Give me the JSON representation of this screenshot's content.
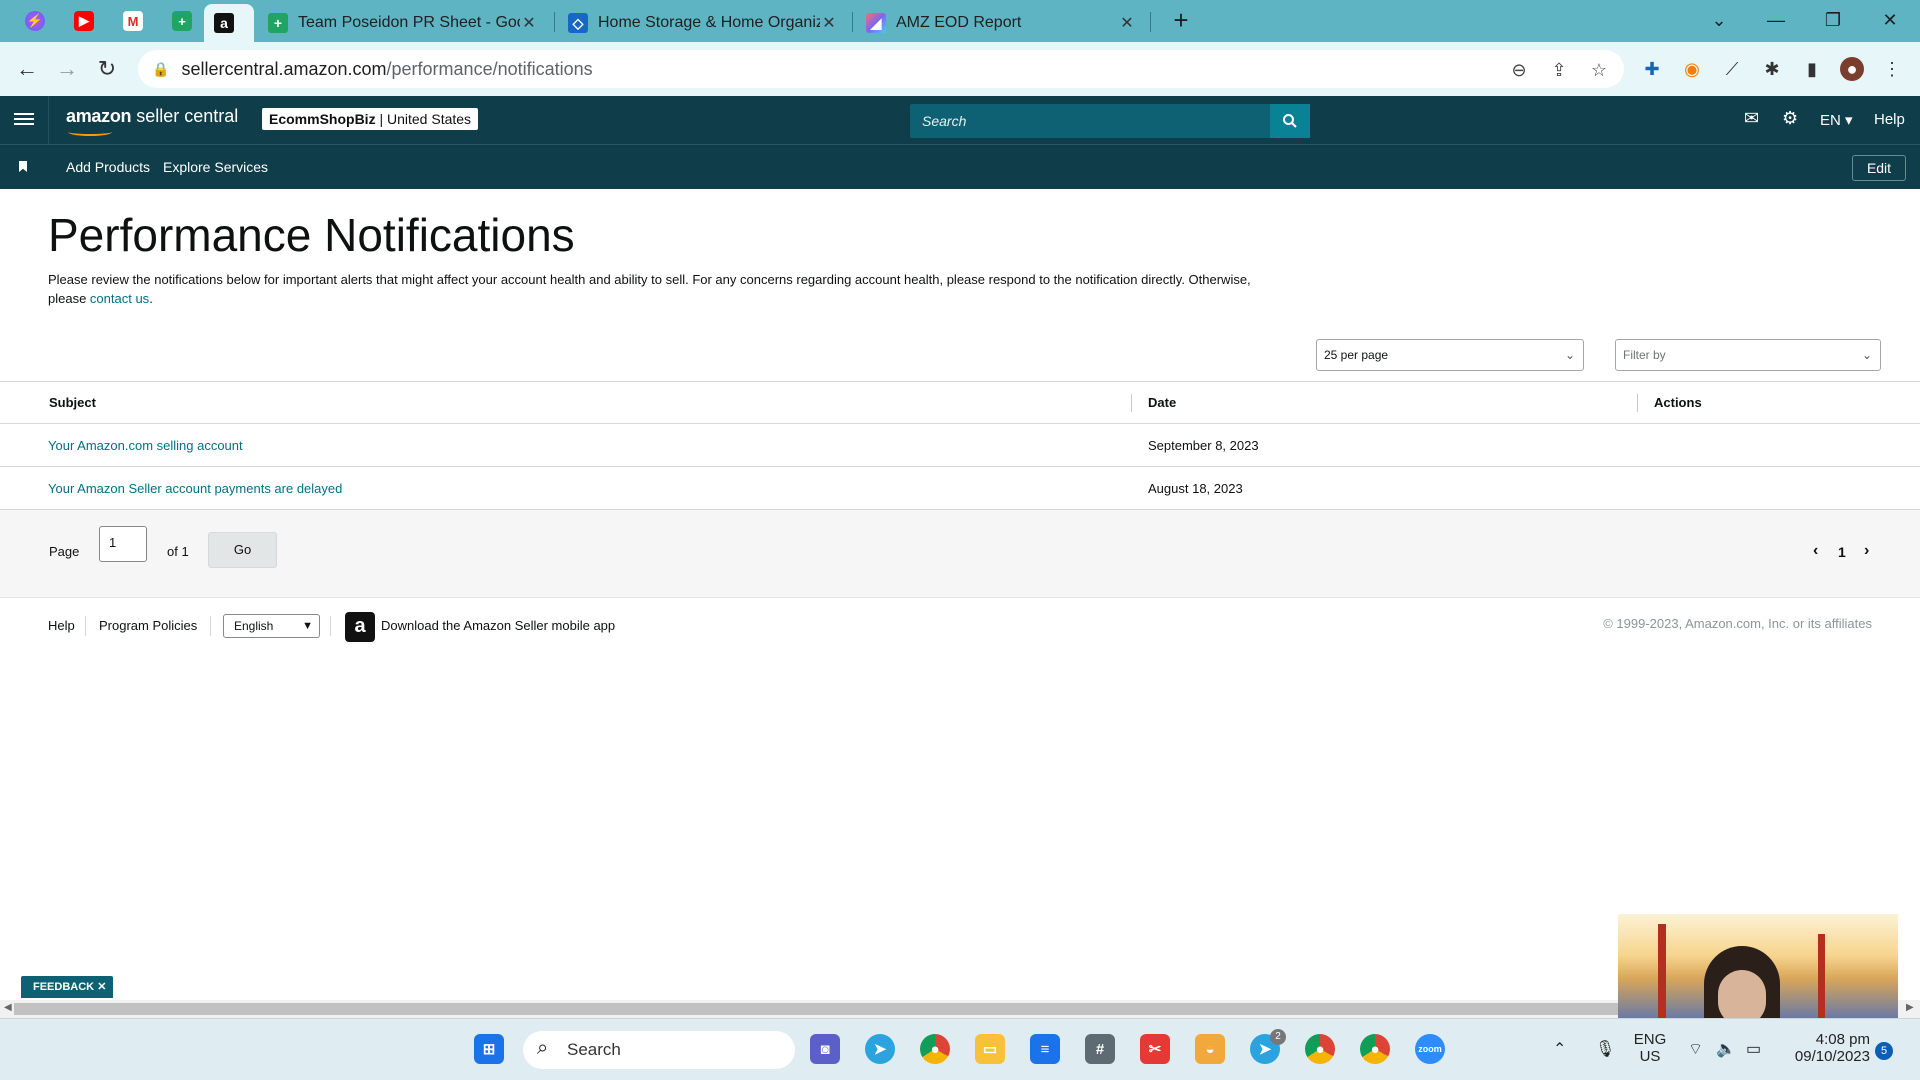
{
  "browser": {
    "tabs": [
      {
        "title": "Team Poseidon PR Sheet - Goog",
        "icon": "sheets-icon"
      },
      {
        "title": "Home Storage & Home Organiz",
        "icon": "diamond-logo-icon"
      },
      {
        "title": "AMZ EOD Report",
        "icon": "clickup-icon"
      }
    ],
    "url_host": "sellercentral.amazon.com",
    "url_path": "/performance/notifications"
  },
  "header": {
    "logo_main": "amazon",
    "logo_sub": "seller central",
    "store_name": "EcommShopBiz",
    "store_sep": " | ",
    "store_region": "United States",
    "search_placeholder": "Search",
    "language": "EN",
    "help": "Help"
  },
  "subnav": {
    "items": [
      "Add Products",
      "Explore Services"
    ],
    "edit": "Edit"
  },
  "page": {
    "title": "Performance Notifications",
    "description": "Please review the notifications below for important alerts that might affect your account health and ability to sell. For any concerns regarding account health, please respond to the notification directly. Otherwise, please ",
    "contact_link": "contact us",
    "description_end": ".",
    "per_page": "25 per page",
    "filter_placeholder": "Filter by"
  },
  "table": {
    "headers": {
      "subject": "Subject",
      "date": "Date",
      "actions": "Actions"
    },
    "rows": [
      {
        "subject": "Your Amazon.com selling account",
        "date": "September 8, 2023"
      },
      {
        "subject": "Your Amazon Seller account payments are delayed",
        "date": "August 18, 2023"
      }
    ]
  },
  "pagination": {
    "page_label": "Page",
    "current_page": "1",
    "of_label": "of 1",
    "go": "Go",
    "page_number": "1"
  },
  "footer": {
    "help": "Help",
    "policies": "Program Policies",
    "language": "English",
    "app_link": "Download the Amazon Seller mobile app",
    "copyright": "© 1999-2023, Amazon.com, Inc. or its affiliates"
  },
  "feedback": "FEEDBACK",
  "taskbar": {
    "search": "Search",
    "lang_line1": "ENG",
    "lang_line2": "US",
    "time": "4:08 pm",
    "date": "09/10/2023",
    "notifications": "5",
    "telegram_badge": "2"
  },
  "colors": {
    "tabstrip": "#5fb4c4",
    "amazon_header": "#0f3d4a",
    "link": "#007185",
    "accent": "#ff9900"
  }
}
